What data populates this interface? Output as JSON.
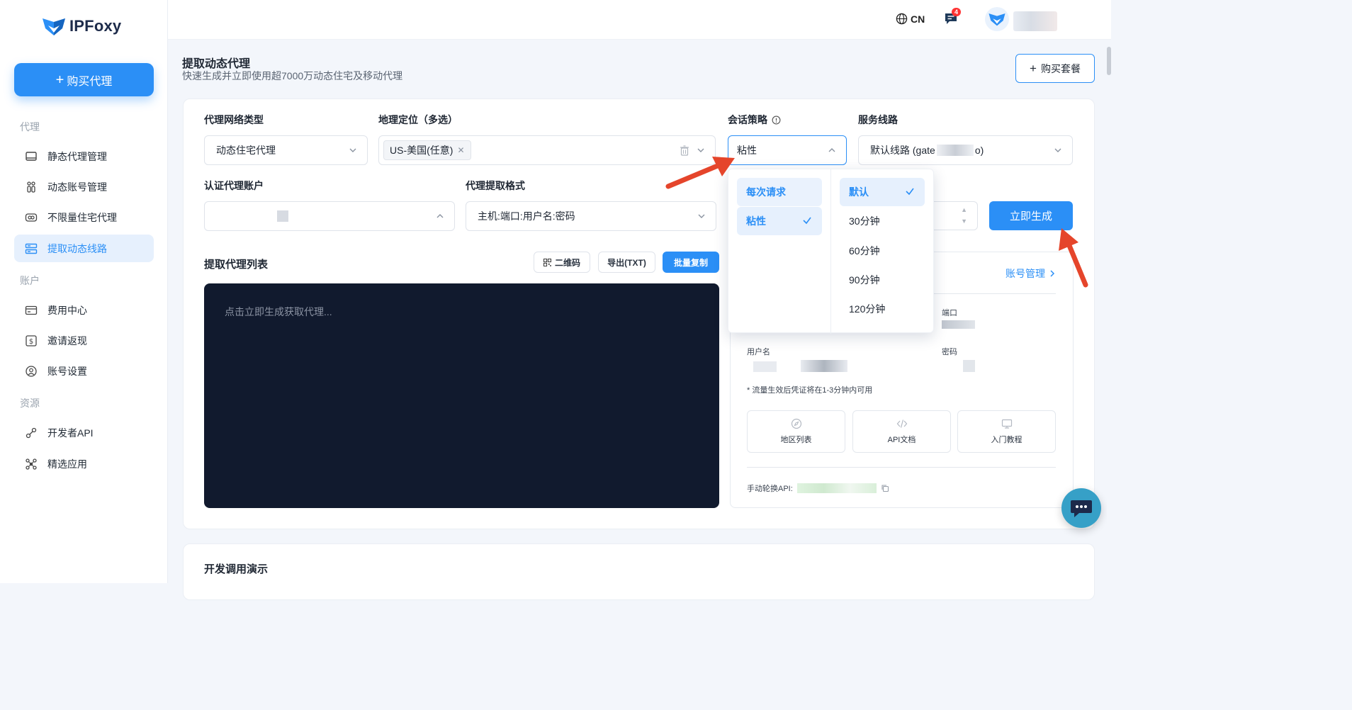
{
  "app": {
    "logo_text": "IPFoxy"
  },
  "sidebar": {
    "buy_button": "购买代理",
    "sections": {
      "proxy": "代理",
      "account": "账户",
      "resources": "资源"
    },
    "items": [
      {
        "label": "静态代理管理",
        "icon": "monitor-icon"
      },
      {
        "label": "动态账号管理",
        "icon": "users-icon"
      },
      {
        "label": "不限量住宅代理",
        "icon": "infinity-icon"
      },
      {
        "label": "提取动态线路",
        "icon": "server-icon",
        "active": true
      },
      {
        "label": "费用中心",
        "icon": "card-icon"
      },
      {
        "label": "邀请返现",
        "icon": "dollar-icon"
      },
      {
        "label": "账号设置",
        "icon": "user-circle-icon"
      },
      {
        "label": "开发者API",
        "icon": "api-icon"
      },
      {
        "label": "精选应用",
        "icon": "apps-icon"
      }
    ]
  },
  "topbar": {
    "lang": "CN",
    "message_count": "4"
  },
  "page": {
    "title": "提取动态代理",
    "subtitle": "快速生成并立即使用超7000万动态住宅及移动代理",
    "buy_package": "购买套餐"
  },
  "form": {
    "network_type_label": "代理网络类型",
    "network_type_value": "动态住宅代理",
    "geo_label": "地理定位（多选）",
    "geo_chip": "US-美国(任意)",
    "session_label": "会话策略",
    "session_value": "粘性",
    "route_label": "服务线路",
    "route_value_prefix": "默认线路 (gate",
    "route_value_suffix": "o)",
    "auth_label": "认证代理账户",
    "format_label": "代理提取格式",
    "format_value": "主机:端口:用户名:密码",
    "generate": "立即生成"
  },
  "list": {
    "title": "提取代理列表",
    "qr": "二维码",
    "export": "导出(TXT)",
    "copy": "批量复制",
    "placeholder": "点击立即生成获取代理..."
  },
  "dropdown": {
    "modes": [
      {
        "label": "每次请求",
        "selected": false
      },
      {
        "label": "粘性",
        "selected": true
      }
    ],
    "durations": [
      {
        "label": "默认",
        "selected": true
      },
      {
        "label": "30分钟",
        "selected": false
      },
      {
        "label": "60分钟",
        "selected": false
      },
      {
        "label": "90分钟",
        "selected": false
      },
      {
        "label": "120分钟",
        "selected": false
      }
    ]
  },
  "panel": {
    "account_link": "账号管理",
    "port_label": "端口",
    "user_label": "用户名",
    "pwd_label": "密码",
    "note": "* 流量生效后凭证将在1-3分钟内可用",
    "tiles": [
      "地区列表",
      "API文档",
      "入门教程"
    ],
    "api_label": "手动轮换API:"
  },
  "dev": {
    "title": "开发调用演示"
  },
  "colors": {
    "primary": "#2b8ff6",
    "dark_bg": "#111a2e",
    "arrow": "#e5452b"
  }
}
